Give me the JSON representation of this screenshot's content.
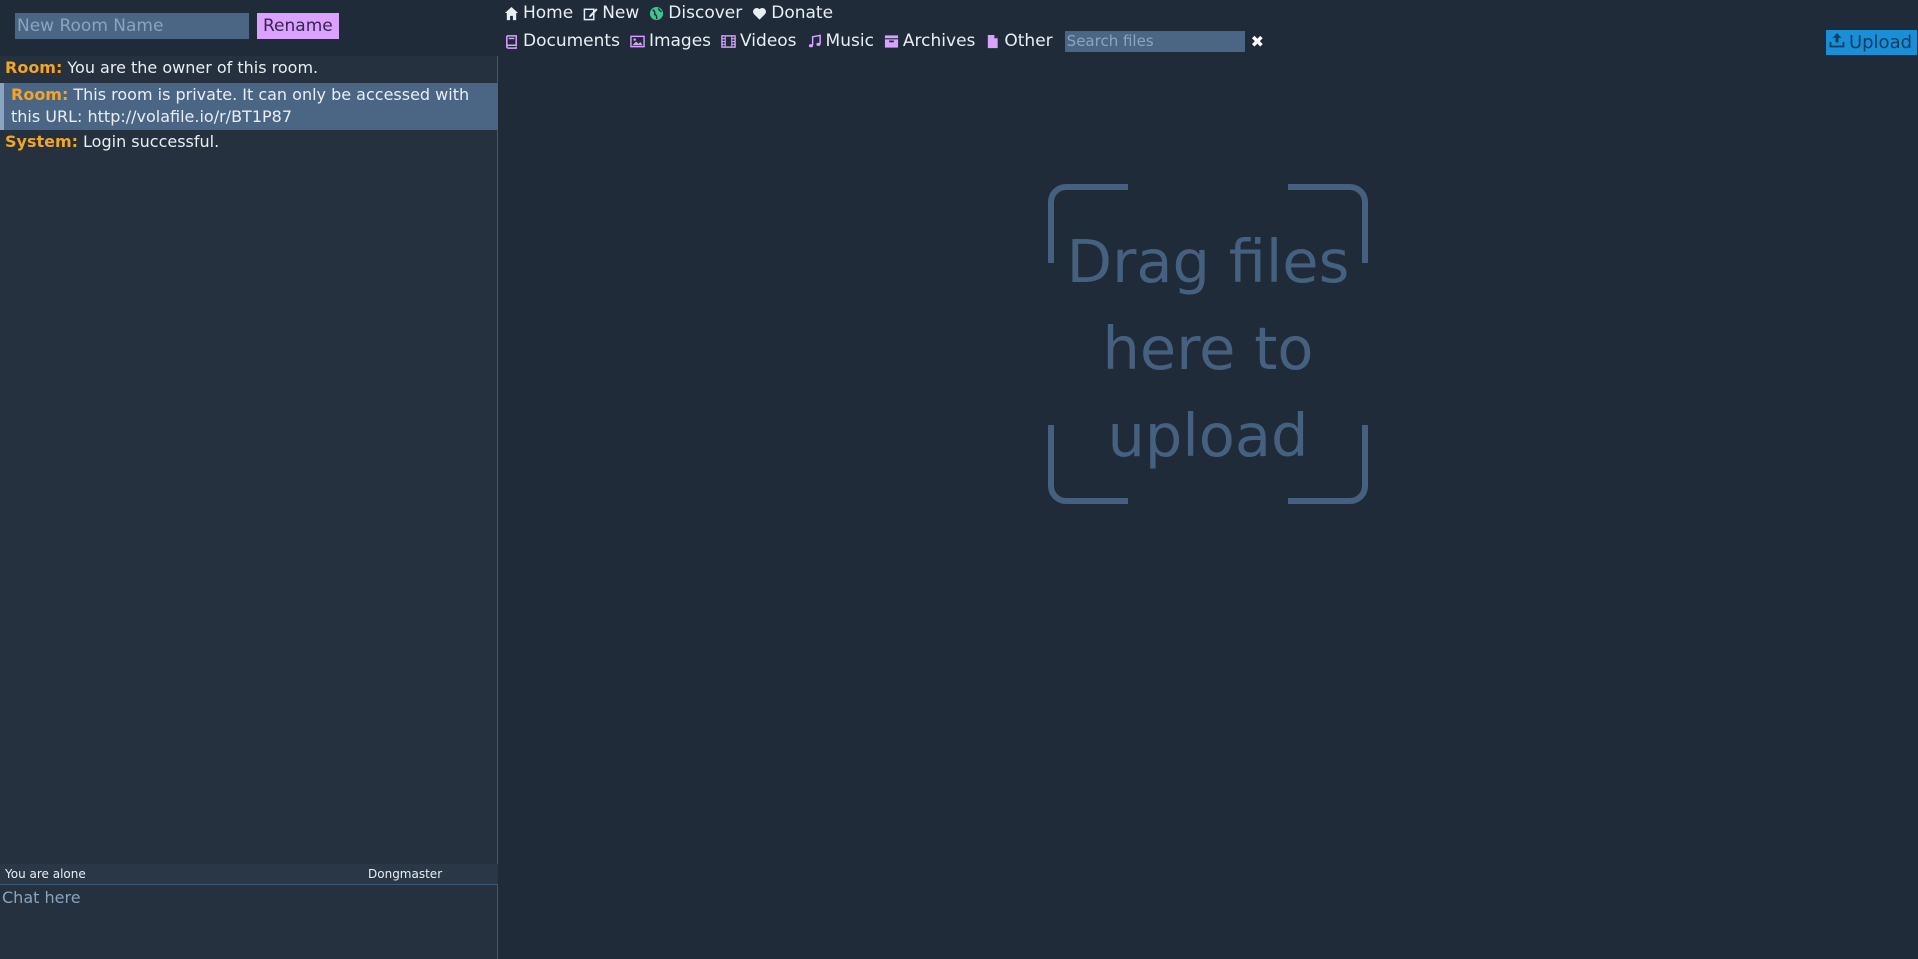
{
  "chat": {
    "rename_placeholder": "New Room Name",
    "rename_label": "Rename",
    "messages": [
      {
        "author": "Room:",
        "text": "You are the owner of this room.",
        "highlight": false
      },
      {
        "author": "Room:",
        "text": "This room is private. It can only be accessed with this URL: http://volafile.io/r/BT1P87",
        "highlight": true
      },
      {
        "author": "System:",
        "text": "Login successful.",
        "highlight": false
      }
    ],
    "user_count_text": "You are alone",
    "username": "Dongmaster",
    "input_placeholder": "Chat here"
  },
  "nav": {
    "items": [
      {
        "label": "Home",
        "icon": "home-icon"
      },
      {
        "label": "New",
        "icon": "edit-icon"
      },
      {
        "label": "Discover",
        "icon": "globe-icon"
      },
      {
        "label": "Donate",
        "icon": "heart-icon"
      }
    ]
  },
  "filters": {
    "items": [
      {
        "label": "Documents",
        "icon": "book-icon"
      },
      {
        "label": "Images",
        "icon": "image-icon"
      },
      {
        "label": "Videos",
        "icon": "film-icon"
      },
      {
        "label": "Music",
        "icon": "music-icon"
      },
      {
        "label": "Archives",
        "icon": "archive-icon"
      },
      {
        "label": "Other",
        "icon": "file-icon"
      }
    ],
    "search_placeholder": "Search files",
    "clear_symbol": "✖"
  },
  "upload": {
    "label": "Upload",
    "icon": "upload-icon"
  },
  "dropzone": {
    "lines": [
      "Drag files",
      "here to",
      "upload"
    ]
  },
  "colors": {
    "background": "#1f2b38",
    "chat_background": "#25313e",
    "author": "#f2a526",
    "highlight": "#4b6685",
    "accent_purple": "#d9a2ff",
    "upload_blue": "#1a8fd6",
    "dropzone": "#45617f",
    "discover_green": "#3ec48e"
  }
}
